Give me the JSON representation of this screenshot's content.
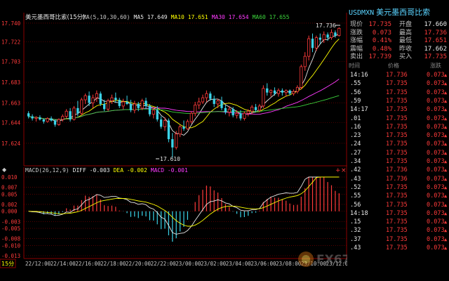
{
  "price_panel": {
    "title": "美元墨西哥比索(15分)",
    "ma_line": [
      {
        "text": "MA(5,10,30,60)",
        "color": "#c8c8c8"
      },
      {
        "text": "MA5 17.649",
        "color": "#e8e8e8"
      },
      {
        "text": "MA10 17.651",
        "color": "#ffff00"
      },
      {
        "text": "MA30 17.654",
        "color": "#ff3bff"
      },
      {
        "text": "MA60 17.655",
        "color": "#3bd33b"
      }
    ],
    "y_ticks": [
      "17.740",
      "17.722",
      "17.703",
      "17.683",
      "17.663",
      "17.644",
      "17.624"
    ],
    "high_label": "17.736",
    "low_label": "17.610"
  },
  "macd_panel": {
    "label_line": [
      {
        "text": "MACD(26,12,9)",
        "color": "#c8c8c8"
      },
      {
        "text": "DIFF -0.003",
        "color": "#e8e8e8"
      },
      {
        "text": "DEA -0.002",
        "color": "#ffff00"
      },
      {
        "text": "MACD -0.001",
        "color": "#ff3bff"
      }
    ],
    "y_ticks": [
      "0.010",
      "0.007",
      "0.005",
      "0.002",
      "0.000",
      "-0.003",
      "-0.005",
      "-0.008",
      "-0.010",
      "-0.013"
    ]
  },
  "bottom_bar": {
    "period": "15分",
    "time_labels": [
      "22/12:00",
      "22/14:00",
      "22/16:00",
      "22/18:00",
      "22/20:00",
      "22/22:00",
      "23/00:00",
      "23/02:00",
      "23/04:00",
      "23/06:00",
      "23/08:00",
      "23/10:00",
      "23/12:00"
    ]
  },
  "quote": {
    "code": "USDMXN",
    "name": "美元墨西哥比索",
    "rows": [
      {
        "l1": "现价",
        "v1": "17.735",
        "c1": "red",
        "l2": "开盘",
        "v2": "17.660",
        "c2": "white"
      },
      {
        "l1": "涨跌",
        "v1": "0.073",
        "c1": "red",
        "l2": "最高",
        "v2": "17.736",
        "c2": "red"
      },
      {
        "l1": "涨幅",
        "v1": "0.41%",
        "c1": "red",
        "l2": "最低",
        "v2": "17.651",
        "c2": "red"
      },
      {
        "l1": "震幅",
        "v1": "0.48%",
        "c1": "red",
        "l2": "昨收",
        "v2": "17.662",
        "c2": "white"
      },
      {
        "l1": "卖出",
        "v1": "17.739",
        "c1": "red",
        "l2": "买入",
        "v2": "17.735",
        "c2": "red"
      }
    ],
    "ticks_header": [
      "时间",
      "价格",
      "涨跌"
    ],
    "ticks": [
      {
        "t": "14:16",
        "p": "17.736",
        "c": "0.073"
      },
      {
        "t": ".55",
        "p": "17.735",
        "c": "0.073"
      },
      {
        "t": ".56",
        "p": "17.735",
        "c": "0.073"
      },
      {
        "t": ".59",
        "p": "17.735",
        "c": "0.073"
      },
      {
        "t": "14:17",
        "p": "17.735",
        "c": "0.073"
      },
      {
        "t": ".01",
        "p": "17.735",
        "c": "0.073"
      },
      {
        "t": ".16",
        "p": "17.735",
        "c": "0.073"
      },
      {
        "t": ".23",
        "p": "17.735",
        "c": "0.073"
      },
      {
        "t": ".24",
        "p": "17.735",
        "c": "0.073"
      },
      {
        "t": ".27",
        "p": "17.735",
        "c": "0.073"
      },
      {
        "t": ".34",
        "p": "17.735",
        "c": "0.073"
      },
      {
        "t": ".42",
        "p": "17.736",
        "c": "0.073"
      },
      {
        "t": ".43",
        "p": "17.736",
        "c": "0.073"
      },
      {
        "t": ".52",
        "p": "17.735",
        "c": "0.073"
      },
      {
        "t": ".55",
        "p": "17.735",
        "c": "0.073"
      },
      {
        "t": ".56",
        "p": "17.735",
        "c": "0.073"
      },
      {
        "t": "14:18",
        "p": "17.735",
        "c": "0.073"
      },
      {
        "t": ".15",
        "p": "17.735",
        "c": "0.073"
      },
      {
        "t": ".32",
        "p": "17.735",
        "c": "0.073"
      },
      {
        "t": ".37",
        "p": "17.735",
        "c": "0.073"
      },
      {
        "t": ".43",
        "p": "17.735",
        "c": "0.073"
      }
    ]
  },
  "watermark": "FX678 汇通网",
  "colors": {
    "up": "#ff3b3b",
    "down": "#3bd3e8",
    "ma5": "#e8e8e8",
    "ma10": "#ffff00",
    "ma30": "#ff3bff",
    "ma60": "#3bd33b",
    "grid": "#8b0000"
  },
  "chart_data": {
    "type": "candlestick",
    "title": "美元墨西哥比索(15分)",
    "ylim": [
      17.605,
      17.742
    ],
    "candles": [
      [
        17.653,
        17.655,
        17.648,
        17.65
      ],
      [
        17.65,
        17.652,
        17.646,
        17.648
      ],
      [
        17.648,
        17.65,
        17.645,
        17.649
      ],
      [
        17.649,
        17.651,
        17.646,
        17.647
      ],
      [
        17.647,
        17.648,
        17.643,
        17.645
      ],
      [
        17.645,
        17.649,
        17.644,
        17.648
      ],
      [
        17.648,
        17.65,
        17.645,
        17.646
      ],
      [
        17.646,
        17.647,
        17.64,
        17.642
      ],
      [
        17.642,
        17.648,
        17.641,
        17.647
      ],
      [
        17.647,
        17.652,
        17.645,
        17.65
      ],
      [
        17.65,
        17.657,
        17.648,
        17.655
      ],
      [
        17.655,
        17.658,
        17.645,
        17.647
      ],
      [
        17.647,
        17.66,
        17.646,
        17.658
      ],
      [
        17.658,
        17.665,
        17.65,
        17.653
      ],
      [
        17.653,
        17.668,
        17.651,
        17.666
      ],
      [
        17.666,
        17.672,
        17.662,
        17.67
      ],
      [
        17.67,
        17.674,
        17.66,
        17.663
      ],
      [
        17.663,
        17.671,
        17.658,
        17.668
      ],
      [
        17.668,
        17.675,
        17.664,
        17.672
      ],
      [
        17.672,
        17.674,
        17.66,
        17.662
      ],
      [
        17.662,
        17.666,
        17.655,
        17.657
      ],
      [
        17.657,
        17.667,
        17.655,
        17.665
      ],
      [
        17.665,
        17.671,
        17.662,
        17.668
      ],
      [
        17.668,
        17.673,
        17.663,
        17.666
      ],
      [
        17.666,
        17.668,
        17.658,
        17.66
      ],
      [
        17.66,
        17.667,
        17.657,
        17.664
      ],
      [
        17.664,
        17.67,
        17.661,
        17.662
      ],
      [
        17.662,
        17.666,
        17.654,
        17.656
      ],
      [
        17.656,
        17.665,
        17.653,
        17.662
      ],
      [
        17.662,
        17.664,
        17.655,
        17.658
      ],
      [
        17.658,
        17.667,
        17.656,
        17.665
      ],
      [
        17.665,
        17.668,
        17.657,
        17.66
      ],
      [
        17.66,
        17.662,
        17.65,
        17.652
      ],
      [
        17.652,
        17.659,
        17.648,
        17.656
      ],
      [
        17.656,
        17.66,
        17.645,
        17.647
      ],
      [
        17.647,
        17.65,
        17.638,
        17.64
      ],
      [
        17.64,
        17.649,
        17.636,
        17.646
      ],
      [
        17.646,
        17.648,
        17.625,
        17.628
      ],
      [
        17.628,
        17.634,
        17.61,
        17.62
      ],
      [
        17.62,
        17.636,
        17.618,
        17.633
      ],
      [
        17.633,
        17.642,
        17.63,
        17.64
      ],
      [
        17.64,
        17.646,
        17.636,
        17.638
      ],
      [
        17.638,
        17.647,
        17.637,
        17.645
      ],
      [
        17.645,
        17.655,
        17.643,
        17.653
      ],
      [
        17.653,
        17.664,
        17.65,
        17.661
      ],
      [
        17.661,
        17.668,
        17.657,
        17.664
      ],
      [
        17.664,
        17.671,
        17.662,
        17.668
      ],
      [
        17.668,
        17.675,
        17.664,
        17.672
      ],
      [
        17.672,
        17.674,
        17.665,
        17.667
      ],
      [
        17.667,
        17.67,
        17.659,
        17.662
      ],
      [
        17.662,
        17.667,
        17.658,
        17.665
      ],
      [
        17.665,
        17.669,
        17.656,
        17.658
      ],
      [
        17.658,
        17.661,
        17.652,
        17.654
      ],
      [
        17.654,
        17.66,
        17.65,
        17.657
      ],
      [
        17.657,
        17.659,
        17.649,
        17.651
      ],
      [
        17.651,
        17.656,
        17.648,
        17.653
      ],
      [
        17.653,
        17.656,
        17.646,
        17.648
      ],
      [
        17.648,
        17.655,
        17.646,
        17.653
      ],
      [
        17.653,
        17.657,
        17.65,
        17.655
      ],
      [
        17.655,
        17.661,
        17.652,
        17.659
      ],
      [
        17.659,
        17.662,
        17.654,
        17.656
      ],
      [
        17.656,
        17.662,
        17.654,
        17.66
      ],
      [
        17.66,
        17.68,
        17.658,
        17.677
      ],
      [
        17.677,
        17.682,
        17.67,
        17.673
      ],
      [
        17.673,
        17.676,
        17.669,
        17.675
      ],
      [
        17.675,
        17.678,
        17.67,
        17.672
      ],
      [
        17.672,
        17.677,
        17.669,
        17.675
      ],
      [
        17.675,
        17.677,
        17.67,
        17.673
      ],
      [
        17.673,
        17.676,
        17.669,
        17.675
      ],
      [
        17.675,
        17.676,
        17.67,
        17.672
      ],
      [
        17.672,
        17.676,
        17.67,
        17.674
      ],
      [
        17.674,
        17.68,
        17.672,
        17.678
      ],
      [
        17.678,
        17.7,
        17.676,
        17.698
      ],
      [
        17.698,
        17.712,
        17.694,
        17.708
      ],
      [
        17.708,
        17.728,
        17.704,
        17.725
      ],
      [
        17.725,
        17.73,
        17.712,
        17.716
      ],
      [
        17.716,
        17.728,
        17.713,
        17.726
      ],
      [
        17.726,
        17.73,
        17.72,
        17.724
      ],
      [
        17.724,
        17.732,
        17.721,
        17.729
      ],
      [
        17.729,
        17.731,
        17.723,
        17.726
      ],
      [
        17.726,
        17.734,
        17.724,
        17.731
      ],
      [
        17.731,
        17.733,
        17.726,
        17.728
      ],
      [
        17.728,
        17.736,
        17.727,
        17.735
      ]
    ]
  }
}
